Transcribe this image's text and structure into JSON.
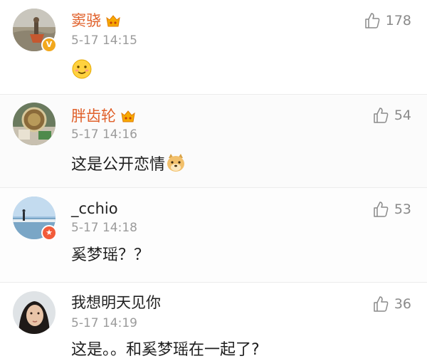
{
  "comments": [
    {
      "username": "窦骁",
      "time": "5-17 14:15",
      "content": "",
      "likes": "178",
      "verified_badge": "v-icon",
      "has_vip_icon": true,
      "content_emoji": "smile-emoji"
    },
    {
      "username": "胖齿轮",
      "time": "5-17 14:16",
      "content": "这是公开恋情",
      "likes": "54",
      "has_vip_icon": true,
      "content_emoji": "doge-emoji"
    },
    {
      "username": "_cchio",
      "time": "5-17 14:18",
      "content": "奚梦瑶？？",
      "likes": "53",
      "verified_badge": "star-icon"
    },
    {
      "username": "我想明天见你",
      "time": "5-17 14:19",
      "content": "这是。。和奚梦瑶在一起了?",
      "likes": "36"
    }
  ],
  "colors": {
    "username_highlight": "#e0602a",
    "username_plain": "#222222",
    "timestamp": "#9b9b9b",
    "like_text": "#8a8a8a"
  }
}
